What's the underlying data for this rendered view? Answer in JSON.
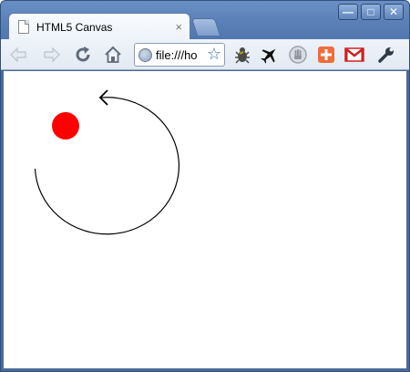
{
  "browser": {
    "tab": {
      "title": "HTML5 Canvas",
      "close_glyph": "×"
    },
    "window_controls": {
      "minimize": "—",
      "maximize": "□",
      "close": "✕"
    },
    "toolbar": {
      "url": "file:///ho",
      "icons": [
        "back-icon",
        "forward-icon",
        "reload-icon",
        "home-icon",
        "bookmark-star-icon",
        "bug-extension-icon",
        "airplane-extension-icon",
        "stop-hand-extension-icon",
        "plus-extension-icon",
        "gmail-extension-icon",
        "wrench-icon"
      ]
    }
  },
  "canvas": {
    "shapes": [
      "red-circle",
      "arc-with-arrow"
    ],
    "colors": {
      "circle_fill": "#ff0000",
      "arc_stroke": "#000000",
      "background": "#ffffff"
    }
  }
}
